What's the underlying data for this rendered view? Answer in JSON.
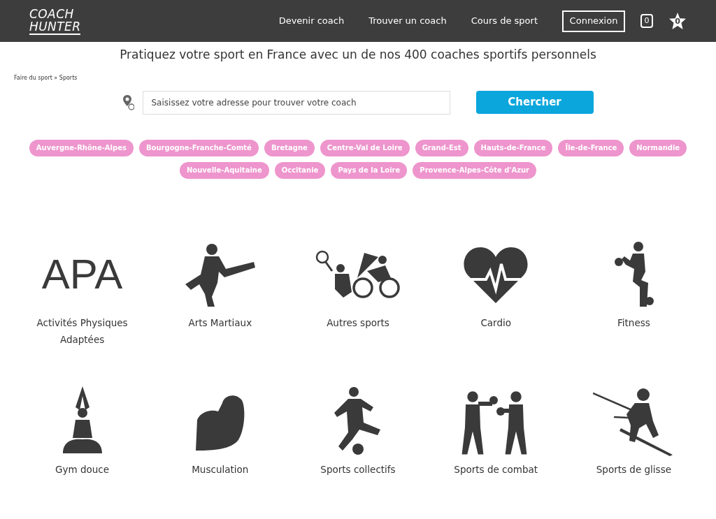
{
  "header": {
    "logo": [
      "COACH",
      "HUNTER"
    ],
    "nav": [
      "Devenir coach",
      "Trouver un coach",
      "Cours de sport"
    ],
    "login": "Connexion",
    "cart_count": "0",
    "favorites_count": "0"
  },
  "title": "Pratiquez votre sport en France avec un de nos 400 coaches sportifs personnels",
  "breadcrumb": "Faire du sport » Sports",
  "search": {
    "placeholder": "Saisissez votre adresse pour trouver votre coach",
    "button": "Chercher"
  },
  "regions": [
    "Auvergne-Rhône-Alpes",
    "Bourgogne-Franche-Comté",
    "Bretagne",
    "Centre-Val de Loire",
    "Grand-Est",
    "Hauts-de-France",
    "Île-de-France",
    "Normandie",
    "Nouvelle-Aquitaine",
    "Occitanie",
    "Pays de la Loire",
    "Provence-Alpes-Côte d'Azur"
  ],
  "sports": [
    {
      "kind": "text",
      "logo_text": "APA",
      "label": "Activités Physiques Adaptées"
    },
    {
      "kind": "icon",
      "label": "Arts Martiaux"
    },
    {
      "kind": "icon",
      "label": "Autres sports"
    },
    {
      "kind": "icon",
      "label": "Cardio"
    },
    {
      "kind": "icon",
      "label": "Fitness"
    },
    {
      "kind": "icon",
      "label": "Gym douce"
    },
    {
      "kind": "icon",
      "label": "Musculation"
    },
    {
      "kind": "icon",
      "label": "Sports collectifs"
    },
    {
      "kind": "icon",
      "label": "Sports de combat"
    },
    {
      "kind": "icon",
      "label": "Sports de glisse"
    }
  ]
}
